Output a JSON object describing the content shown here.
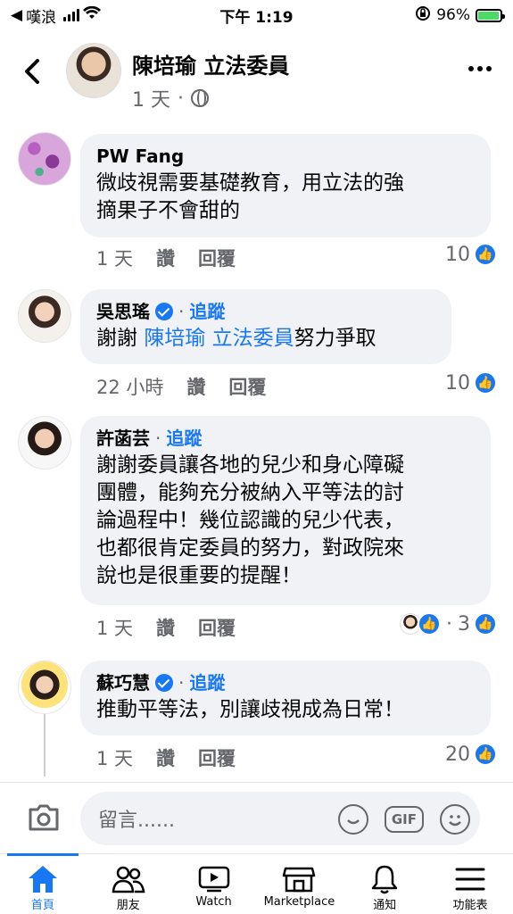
{
  "status": {
    "carrier": "嘆浪",
    "time": "下午 1:19",
    "battery_percent": "96%"
  },
  "header": {
    "title": "陳培瑜 立法委員",
    "time": "1 天",
    "sep": "·"
  },
  "comments": [
    {
      "author": "PW Fang",
      "verified": false,
      "follow": "",
      "text_lines": [
        "微歧視需要基礎教育，用立法的強",
        "摘果子不會甜的"
      ],
      "time": "1 天",
      "like": "讚",
      "reply": "回覆",
      "count": "10"
    },
    {
      "author": "吳思瑤",
      "verified": true,
      "follow": "追蹤",
      "text_prefix": "謝謝 ",
      "mention": "陳培瑜 立法委員",
      "text_suffix": "努力爭取",
      "time": "22 小時",
      "like": "讚",
      "reply": "回覆",
      "count": "10"
    },
    {
      "author": "許菡芸",
      "verified": false,
      "follow": "追蹤",
      "text_lines": [
        "謝謝委員讓各地的兒少和身心障礙",
        "團體，能夠充分被納入平等法的討",
        "論過程中！幾位認識的兒少代表，",
        "也都很肯定委員的努力，對政院來",
        "說也是很重要的提醒！"
      ],
      "time": "1 天",
      "like": "讚",
      "reply": "回覆",
      "count": "3"
    },
    {
      "author": "蘇巧慧",
      "verified": true,
      "follow": "追蹤",
      "text_lines": [
        "推動平等法，別讓歧視成為日常！"
      ],
      "time": "1 天",
      "like": "讚",
      "reply": "回覆",
      "count": "20"
    }
  ],
  "composer": {
    "placeholder": "留言......",
    "gif": "GIF"
  },
  "nav": [
    {
      "label": "首頁",
      "icon": "home-icon",
      "active": true
    },
    {
      "label": "朋友",
      "icon": "friends-icon"
    },
    {
      "label": "Watch",
      "icon": "watch-icon"
    },
    {
      "label": "Marketplace",
      "icon": "marketplace-icon"
    },
    {
      "label": "通知",
      "icon": "bell-icon"
    },
    {
      "label": "功能表",
      "icon": "menu-icon"
    }
  ],
  "colors": {
    "accent": "#1877f2",
    "bubble": "#f0f2f5",
    "muted": "#65676b"
  }
}
